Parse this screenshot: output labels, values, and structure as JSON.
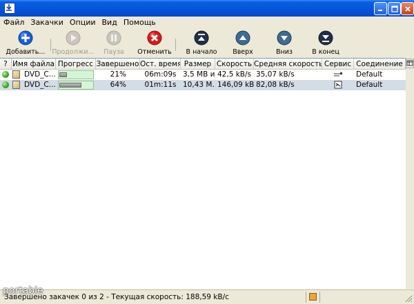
{
  "menu": [
    "Файл",
    "Закачки",
    "Опции",
    "Вид",
    "Помощь"
  ],
  "toolbar": [
    {
      "label": "Добавить...",
      "enabled": true,
      "icon": "add-icon"
    },
    {
      "label": "Продолжи...",
      "enabled": false,
      "icon": "play-icon"
    },
    {
      "label": "Пауза",
      "enabled": false,
      "icon": "pause-icon"
    },
    {
      "label": "Отменить",
      "enabled": true,
      "icon": "cancel-icon"
    },
    {
      "label": "В начало",
      "enabled": true,
      "icon": "move-top-icon"
    },
    {
      "label": "Вверх",
      "enabled": true,
      "icon": "move-up-icon"
    },
    {
      "label": "Вниз",
      "enabled": true,
      "icon": "move-down-icon"
    },
    {
      "label": "В конец",
      "enabled": true,
      "icon": "move-bottom-icon"
    }
  ],
  "columns": [
    "?",
    "Имя файла",
    "Прогресс",
    "Завершено",
    "Ост. время",
    "Размер",
    "Скорость",
    "Средняя скорость",
    "Сервис",
    "Соединение"
  ],
  "rows": [
    {
      "name": "DVD_C...",
      "progress": 0.21,
      "completed": "21%",
      "remaining": "06m:09s",
      "size": "3,5 MB и...",
      "speed": "42,5 kB/s",
      "avg_speed": "35,07 kB/s",
      "connection": "Default",
      "selected": false
    },
    {
      "name": "DVD_C...",
      "progress": 0.64,
      "completed": "64%",
      "remaining": "01m:11s",
      "size": "10,43 M...",
      "speed": "146,09 kB/s",
      "avg_speed": "82,08 kB/s",
      "connection": "Default",
      "selected": true
    }
  ],
  "status": {
    "text": "Завершено закачек 0 из 2 - Текущая скорость: 188,59 kB/c"
  },
  "watermark": "portable",
  "colors": {
    "titlebar": "#0553d8",
    "selected_row": "#d4dce6",
    "cancel": "#d41b1b",
    "add": "#1d5fd1",
    "move": "#2c4f76"
  }
}
